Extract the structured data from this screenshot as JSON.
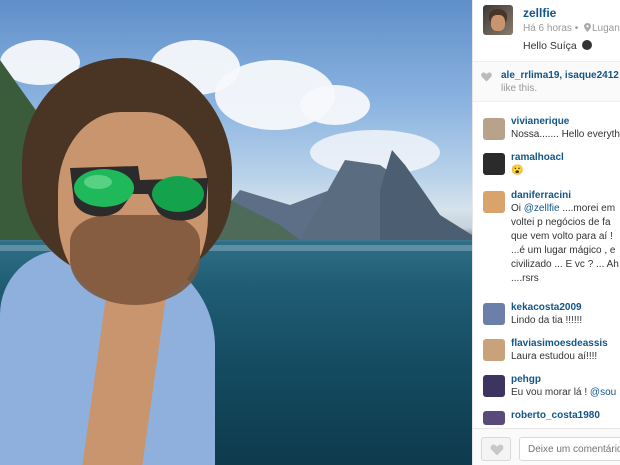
{
  "post": {
    "owner": "zellfie",
    "time": "Há 6 horas",
    "location": "Lugan",
    "caption": "Hello Suíça"
  },
  "likes": {
    "users": "ale_rrlima19, isaque2412",
    "suffix": "like this."
  },
  "comments": [
    {
      "user": "vivianerique",
      "lines": [
        "Nossa....... Hello everyth"
      ],
      "avatar_color": "#b9a28c"
    },
    {
      "user": "ramalhoacl",
      "lines": [
        "😮"
      ],
      "avatar_color": "#2b2b2b"
    },
    {
      "user": "daniferracini",
      "lines": [
        "Oi ",
        "voltei p negócios de fa",
        "que vem volto para aí !",
        "...é um lugar mágico , e",
        "civilizado ... E vc ? ... Ah",
        "....rsrs"
      ],
      "mention": "@zellfie",
      "first_rest": " ....morei em",
      "avatar_color": "#d9a36b"
    },
    {
      "user": "kekacosta2009",
      "lines": [
        "Lindo da tia !!!!!!"
      ],
      "avatar_color": "#6b7fa8"
    },
    {
      "user": "flaviasimoesdeassis",
      "lines": [
        "Laura estudou aí!!!!"
      ],
      "avatar_color": "#c8a27a"
    },
    {
      "user": "pehgp",
      "lines": [
        "Eu vou morar lá ! "
      ],
      "mention": "@sou",
      "avatar_color": "#3d3560"
    },
    {
      "user": "roberto_costa1980",
      "lines": [],
      "avatar_color": "#5a4a7a"
    }
  ],
  "footer": {
    "comment_placeholder": "Deixe um comentário..."
  },
  "colors": {
    "username": "#125688",
    "muted": "#999999"
  },
  "icons": [
    "location-pin-icon",
    "heart-icon",
    "heart-outline-icon"
  ]
}
